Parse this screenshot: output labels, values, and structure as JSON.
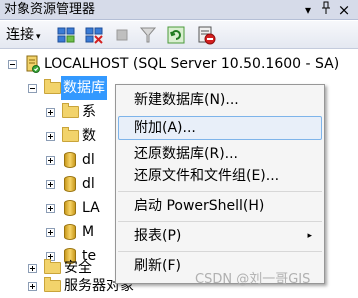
{
  "window": {
    "title": "对象资源管理器",
    "pin_glyph": "▾",
    "pushpin_glyph": "ᵼ",
    "close_glyph": "×"
  },
  "toolbar": {
    "connect_label": "连接",
    "connect_arrow": "▾"
  },
  "tree": {
    "server_label": "LOCALHOST (SQL Server 10.50.1600 - SA)",
    "databases_label": "数据库",
    "children": [
      "系",
      "数",
      "dl",
      "dl",
      "LA",
      "M",
      "te"
    ],
    "security_label": "安全",
    "server_objects_label": "服务器对象"
  },
  "context_menu": {
    "items": [
      {
        "label": "新建数据库(N)...",
        "has_submenu": false
      },
      {
        "label": "附加(A)...",
        "has_submenu": false
      },
      {
        "label": "还原数据库(R)...",
        "has_submenu": false
      },
      {
        "label": "还原文件和文件组(E)...",
        "has_submenu": false
      },
      {
        "label": "启动 PowerShell(H)",
        "has_submenu": false
      },
      {
        "label": "报表(P)",
        "has_submenu": true
      },
      {
        "label": "刷新(F)",
        "has_submenu": false
      }
    ],
    "highlighted_index": 1,
    "submenu_glyph": "▸"
  },
  "watermark": "CSDN @刘一哥GIS",
  "colors": {
    "selection": "#3399ff",
    "menu_highlight_border": "#7eb4ea",
    "menu_background": "#f5f5f5"
  }
}
